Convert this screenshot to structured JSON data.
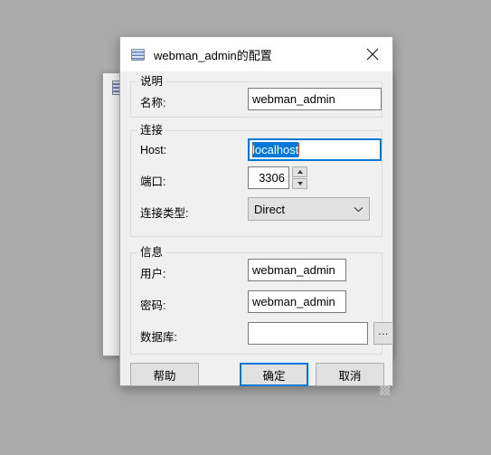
{
  "window": {
    "title": "webman_admin的配置",
    "icon": "database-icon",
    "close_label": "close-icon"
  },
  "groups": {
    "description": {
      "title": "说明",
      "name_label": "名称:",
      "name_value": "webman_admin"
    },
    "connection": {
      "title": "连接",
      "host_label": "Host:",
      "host_value": "localhost",
      "port_label": "端口:",
      "port_value": "3306",
      "conn_type_label": "连接类型:",
      "conn_type_value": "Direct"
    },
    "information": {
      "title": "信息",
      "user_label": "用户:",
      "user_value": "webman_admin",
      "password_label": "密码:",
      "password_value": "webman_admin",
      "database_label": "数据库:",
      "database_value": "",
      "database_browse_label": "..."
    }
  },
  "footer": {
    "help_label": "帮助",
    "ok_label": "确定",
    "cancel_label": "取消"
  },
  "colors": {
    "accent": "#0078d7",
    "dialog_bg": "#f0f0f0",
    "titlebar_bg": "#ffffff",
    "desktop_bg": "#ababab",
    "control_bg": "#e1e1e1",
    "selection_bg": "#0078d7",
    "caret": "#c86432"
  }
}
